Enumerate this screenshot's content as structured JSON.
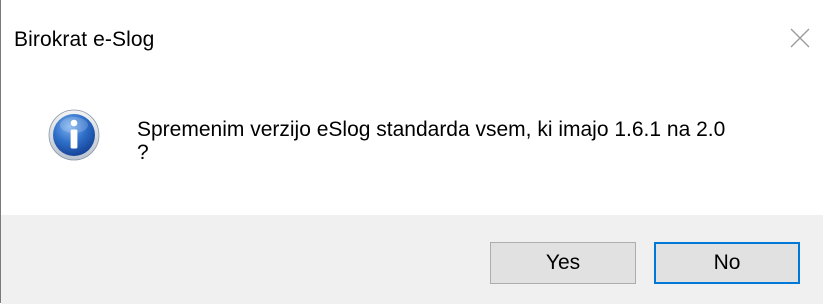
{
  "window": {
    "title": "Birokrat e-Slog",
    "close_icon": "close-icon"
  },
  "message": {
    "icon": "info-icon",
    "text": "Spremenim verzijo eSlog standarda vsem, ki imajo 1.6.1 na 2.0\n?"
  },
  "buttons": {
    "yes_label": "Yes",
    "no_label": "No",
    "default_button": "No"
  },
  "colors": {
    "footer_background": "#f0f0f0",
    "button_background": "#e1e1e1",
    "focus_border": "#0078d7",
    "icon_blue": "#1e5fb4"
  }
}
